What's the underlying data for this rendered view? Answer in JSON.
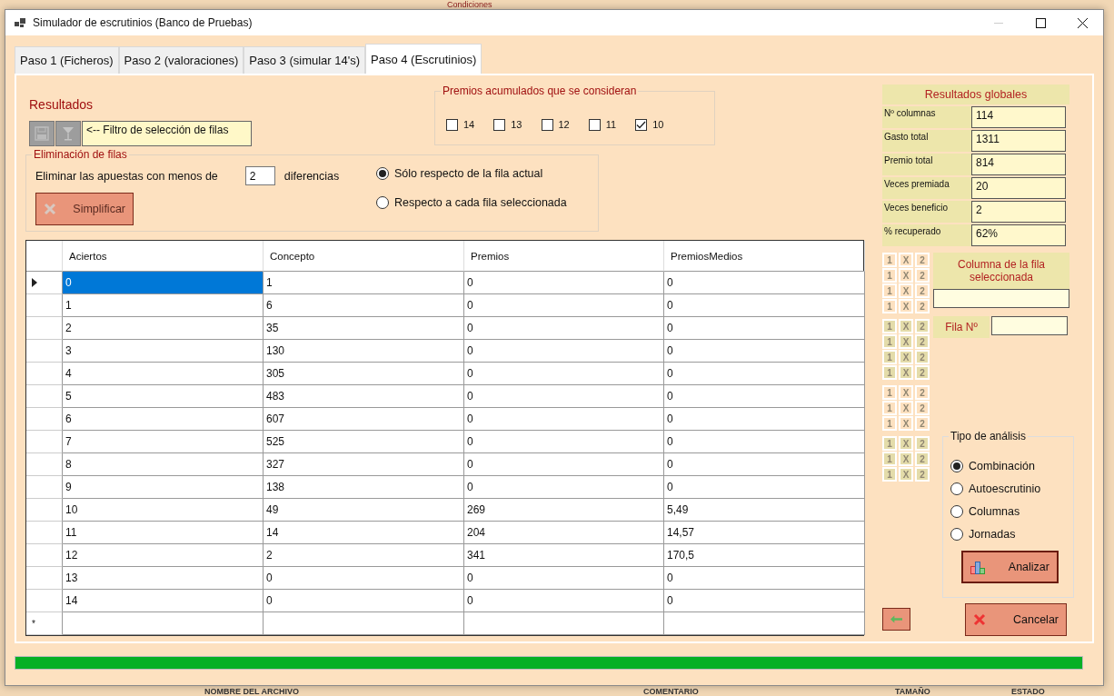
{
  "background": {
    "header": "Condiciones",
    "columns": [
      "NOMBRE DEL ARCHIVO",
      "COMENTARIO",
      "TAMAÑO",
      "ESTADO"
    ]
  },
  "window": {
    "title": "Simulador de escrutinios (Banco de Pruebas)"
  },
  "tabs": [
    {
      "label": "Paso 1 (Ficheros)",
      "selected": false
    },
    {
      "label": "Paso 2 (valoraciones)",
      "selected": false
    },
    {
      "label": "Paso 3 (simular 14's)",
      "selected": false
    },
    {
      "label": "Paso 4 (Escrutinios)",
      "selected": true
    }
  ],
  "results_title": "Resultados",
  "filter_toolbar": {
    "label": "<-- Filtro de selección de filas"
  },
  "premios_group": {
    "title": "Premios acumulados que se consideran",
    "options": [
      {
        "label": "14",
        "checked": false
      },
      {
        "label": "13",
        "checked": false
      },
      {
        "label": "12",
        "checked": false
      },
      {
        "label": "11",
        "checked": false
      },
      {
        "label": "10",
        "checked": true
      }
    ]
  },
  "elimination": {
    "title": "Eliminación de filas",
    "prefix": "Eliminar las apuestas con menos de",
    "value": "2",
    "suffix": "diferencias",
    "button": "Simplificar",
    "scope_options": [
      {
        "label": "Sólo respecto de la fila actual",
        "selected": true
      },
      {
        "label": "Respecto a cada fila seleccionada",
        "selected": false
      }
    ]
  },
  "table": {
    "columns": [
      "Aciertos",
      "Concepto",
      "Premios",
      "PremiosMedios"
    ],
    "rows": [
      {
        "cells": [
          "0",
          "1",
          "0",
          "0"
        ],
        "selected": true
      },
      {
        "cells": [
          "1",
          "6",
          "0",
          "0"
        ],
        "selected": false
      },
      {
        "cells": [
          "2",
          "35",
          "0",
          "0"
        ],
        "selected": false
      },
      {
        "cells": [
          "3",
          "130",
          "0",
          "0"
        ],
        "selected": false
      },
      {
        "cells": [
          "4",
          "305",
          "0",
          "0"
        ],
        "selected": false
      },
      {
        "cells": [
          "5",
          "483",
          "0",
          "0"
        ],
        "selected": false
      },
      {
        "cells": [
          "6",
          "607",
          "0",
          "0"
        ],
        "selected": false
      },
      {
        "cells": [
          "7",
          "525",
          "0",
          "0"
        ],
        "selected": false
      },
      {
        "cells": [
          "8",
          "327",
          "0",
          "0"
        ],
        "selected": false
      },
      {
        "cells": [
          "9",
          "138",
          "0",
          "0"
        ],
        "selected": false
      },
      {
        "cells": [
          "10",
          "49",
          "269",
          "5,49"
        ],
        "selected": false
      },
      {
        "cells": [
          "11",
          "14",
          "204",
          "14,57"
        ],
        "selected": false
      },
      {
        "cells": [
          "12",
          "2",
          "341",
          "170,5"
        ],
        "selected": false
      },
      {
        "cells": [
          "13",
          "0",
          "0",
          "0"
        ],
        "selected": false
      },
      {
        "cells": [
          "14",
          "0",
          "0",
          "0"
        ],
        "selected": false
      }
    ],
    "new_row_marker": "*"
  },
  "global_results": {
    "title": "Resultados globales",
    "items": [
      {
        "label": "Nº columnas",
        "value": "114"
      },
      {
        "label": "Gasto total",
        "value": "1311"
      },
      {
        "label": "Premio total",
        "value": "814"
      },
      {
        "label": "Veces premiada",
        "value": "20"
      },
      {
        "label": "Veces beneficio",
        "value": "2"
      },
      {
        "label": "% recuperado",
        "value": "62%"
      }
    ]
  },
  "quiniela_grid": [
    {
      "shaded": false,
      "rows": [
        [
          "1",
          "X",
          "2"
        ],
        [
          "1",
          "X",
          "2"
        ],
        [
          "1",
          "X",
          "2"
        ],
        [
          "1",
          "X",
          "2"
        ]
      ]
    },
    {
      "shaded": true,
      "rows": [
        [
          "1",
          "X",
          "2"
        ],
        [
          "1",
          "X",
          "2"
        ],
        [
          "1",
          "X",
          "2"
        ],
        [
          "1",
          "X",
          "2"
        ]
      ]
    },
    {
      "shaded": false,
      "rows": [
        [
          "1",
          "X",
          "2"
        ],
        [
          "1",
          "X",
          "2"
        ],
        [
          "1",
          "X",
          "2"
        ]
      ]
    },
    {
      "shaded": true,
      "rows": [
        [
          "1",
          "X",
          "2"
        ],
        [
          "1",
          "X",
          "2"
        ],
        [
          "1",
          "X",
          "2"
        ]
      ]
    }
  ],
  "selected_row_column": {
    "title": "Columna de la fila seleccionada"
  },
  "row_number": {
    "label": "Fila Nº"
  },
  "analysis_type": {
    "title": "Tipo de análisis",
    "options": [
      {
        "label": "Combinación",
        "selected": true
      },
      {
        "label": "Autoescrutinio",
        "selected": false
      },
      {
        "label": "Columnas",
        "selected": false
      },
      {
        "label": "Jornadas",
        "selected": false
      }
    ],
    "button": "Analizar"
  },
  "cancel_button": "Cancelar",
  "progress": {
    "level": 1
  }
}
